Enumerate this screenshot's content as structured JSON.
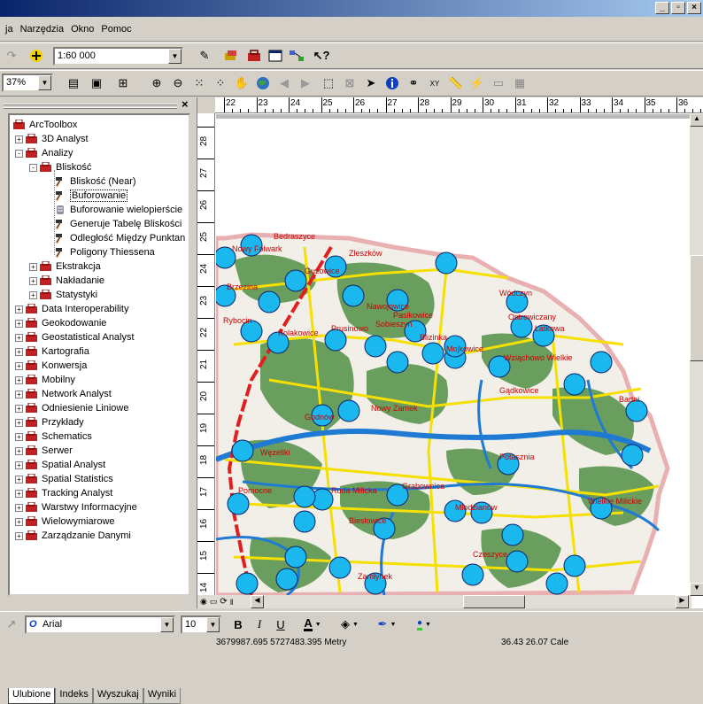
{
  "window": {
    "min_glyph": "_",
    "max_glyph": "▫",
    "close_glyph": "×"
  },
  "menu": {
    "items": [
      "ja",
      "Narzędzia",
      "Okno",
      "Pomoc"
    ]
  },
  "toolbar1": {
    "scale_value": "1:60 000"
  },
  "toolbar2": {
    "zoom_value": "37%"
  },
  "toolbox": {
    "root": "ArcToolbox",
    "items": [
      {
        "label": "3D Analyst",
        "level": 1,
        "expander": "+"
      },
      {
        "label": "Analizy",
        "level": 1,
        "expander": "−"
      },
      {
        "label": "Bliskość",
        "level": 2,
        "expander": "−"
      },
      {
        "label": "Bliskość (Near)",
        "level": 3,
        "tool": "hammer"
      },
      {
        "label": "Buforowanie",
        "level": 3,
        "tool": "hammer",
        "selected": true
      },
      {
        "label": "Buforowanie wielopierście",
        "level": 3,
        "tool": "script"
      },
      {
        "label": "Generuje Tabelę Bliskości",
        "level": 3,
        "tool": "hammer"
      },
      {
        "label": "Odległość Między Punktan",
        "level": 3,
        "tool": "hammer"
      },
      {
        "label": "Poligony Thiessena",
        "level": 3,
        "tool": "hammer"
      },
      {
        "label": "Ekstrakcja",
        "level": 2,
        "expander": "+"
      },
      {
        "label": "Nakładanie",
        "level": 2,
        "expander": "+"
      },
      {
        "label": "Statystyki",
        "level": 2,
        "expander": "+"
      },
      {
        "label": "Data Interoperability",
        "level": 1,
        "expander": "+"
      },
      {
        "label": "Geokodowanie",
        "level": 1,
        "expander": "+"
      },
      {
        "label": "Geostatistical Analyst",
        "level": 1,
        "expander": "+"
      },
      {
        "label": "Kartografia",
        "level": 1,
        "expander": "+"
      },
      {
        "label": "Konwersja",
        "level": 1,
        "expander": "+"
      },
      {
        "label": "Mobilny",
        "level": 1,
        "expander": "+"
      },
      {
        "label": "Network Analyst",
        "level": 1,
        "expander": "+"
      },
      {
        "label": "Odniesienie Liniowe",
        "level": 1,
        "expander": "+"
      },
      {
        "label": "Przykłady",
        "level": 1,
        "expander": "+"
      },
      {
        "label": "Schematics",
        "level": 1,
        "expander": "+"
      },
      {
        "label": "Serwer",
        "level": 1,
        "expander": "+"
      },
      {
        "label": "Spatial Analyst",
        "level": 1,
        "expander": "+"
      },
      {
        "label": "Spatial Statistics",
        "level": 1,
        "expander": "+"
      },
      {
        "label": "Tracking Analyst",
        "level": 1,
        "expander": "+"
      },
      {
        "label": "Warstwy Informacyjne",
        "level": 1,
        "expander": "+"
      },
      {
        "label": "Wielowymiarowe",
        "level": 1,
        "expander": "+"
      },
      {
        "label": "Zarządzanie Danymi",
        "level": 1,
        "expander": "+"
      }
    ],
    "tabs": [
      "Ulubione",
      "Indeks",
      "Wyszukaj",
      "Wyniki"
    ],
    "close_glyph": "×"
  },
  "ruler": {
    "h": [
      "22",
      "23",
      "24",
      "25",
      "26",
      "27",
      "28",
      "29",
      "30",
      "31",
      "32",
      "33",
      "34",
      "35",
      "36"
    ],
    "v": [
      "28",
      "27",
      "26",
      "25",
      "24",
      "23",
      "22",
      "21",
      "20",
      "19",
      "18",
      "17",
      "16",
      "15",
      "14"
    ]
  },
  "map": {
    "labels": [
      "Nowy Folwark",
      "Bedraszyce",
      "Zleszków",
      "Guzowice",
      "Brzezina",
      "Rybocin",
      "Kolakowice",
      "Prusinowo",
      "Sobieszyn",
      "Nawojowice",
      "Pasikowice",
      "Blizinka",
      "Wódczyn",
      "Ostrowiczany",
      "Łatkowa",
      "Wziąchowo Wielkie",
      "Mojkowice",
      "Gądkowice",
      "Bartni",
      "Nowy Zamek",
      "Godnów",
      "Węzeliki",
      "Wielkie Milickie",
      "Ruda Milicka",
      "Grabownica",
      "Potasznia",
      "Pomocne",
      "Biesłowice",
      "Mlodzianów",
      "Czeszyce",
      "Zamłynek"
    ],
    "map_label_color": "#cc0000"
  },
  "drawing": {
    "font_name": "Arial",
    "font_size": "10",
    "bold": "B",
    "italic": "I",
    "underline": "U",
    "font_color_label": "A"
  },
  "status": {
    "coords": "3679987.695  5727483.395 Metry",
    "page_coords": "36.43  26.07 Cale"
  },
  "colors": {
    "accent": "#0a246a",
    "map_green": "#6a9e5e",
    "map_blue": "#1e7ad2",
    "map_yellow": "#f5e000",
    "map_red": "#e02020",
    "circle_fill": "#1ab8ee",
    "boundary": "#e8b0b0"
  }
}
